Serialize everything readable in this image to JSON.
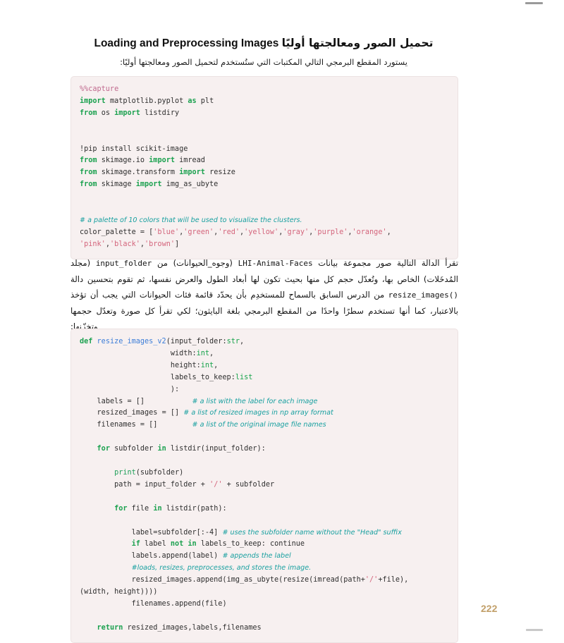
{
  "document": {
    "page_number": "222",
    "heading": {
      "arabic": "تحميل الصور ومعالجتها أوليًا",
      "english": "Loading and Preprocessing Images"
    },
    "subtitle": "يستورد المقطع البرمجي التالي المكتبات التي ستُستخدم لتحميل الصور ومعالجتها أوليًا:",
    "body_paragraph": {
      "part_1": "تقرأ الدالة التالية صور مجموعة بيانات ",
      "inline_code_1": "LHI-Animal-Faces",
      "part_2": " (وجوه_الحيوانات) من ",
      "inline_code_2": "input_folder",
      "part_3": " (مجلد المُدخَلات) الخاص بها، وتُعدّل حجم كل منها بحيث تكون لها أبعاد الطول والعرض نفسها، ثم تقوم بتحسين دالة ",
      "inline_code_3": "resize_images()",
      "part_4": " من الدرس السابق بالسماح للمستخدِم بأن يحدّد قائمة فئات الحيوانات التي يجب أن تؤخذ بالاعتبار، كما أنها تستخدم سطرًا واحدًا من المقطع البرمجي بلغة البايثون؛ لكي تقرأ كل صورة وتعدّل حجمها وتخزّنها:"
    },
    "code_blocks": {
      "imports": {
        "lines": [
          "%%capture",
          "import matplotlib.pyplot as plt",
          "from os import listdiry",
          "",
          "!pip install scikit-image",
          "from skimage.io import imread",
          "from skimage.transform import resize",
          "from skimage import img_as_ubyte",
          "",
          "# a palette of 10 colors that will be used to visualize the clusters.",
          "color_palette = ['blue','green','red','yellow','gray','purple','orange',",
          "'pink','black','brown']"
        ],
        "tokens": {
          "magic_capture": "%%capture",
          "kw_import": "import",
          "kw_from": "from",
          "kw_as": "as",
          "module_matplotlib": "matplotlib.pyplot",
          "alias_plt": "plt",
          "module_os": "os",
          "name_listdiry": "listdiry",
          "shell_pip": "!pip install scikit-image",
          "module_skimage_io": "skimage.io",
          "name_imread": "imread",
          "module_skimage_transform": "skimage.transform",
          "name_resize": "resize",
          "module_skimage": "skimage",
          "name_img_as_ubyte": "img_as_ubyte",
          "comment_palette": "# a palette of 10 colors that will be used to visualize the clusters.",
          "var_color_palette": "color_palette",
          "palette_values": [
            "'blue'",
            "'green'",
            "'red'",
            "'yellow'",
            "'gray'",
            "'purple'",
            "'orange'",
            "'pink'",
            "'black'",
            "'brown'"
          ]
        }
      },
      "function": {
        "tokens": {
          "kw_def": "def",
          "fn_name": "resize_images_v2",
          "param_input_folder": "input_folder",
          "param_width": "width",
          "param_height": "height",
          "param_labels_to_keep": "labels_to_keep",
          "type_str": "str",
          "type_int": "int",
          "type_list": "list",
          "var_labels": "labels",
          "var_resized_images": "resized_images",
          "var_filenames": "filenames",
          "comment_labels": "# a list with the label for each image",
          "comment_resized": "# a list of resized images in np array format",
          "comment_filenames": "# a list of the original image file names",
          "kw_for": "for",
          "kw_in": "in",
          "kw_if": "if",
          "kw_not": "not",
          "kw_continue": "continue",
          "kw_return": "return",
          "builtin_print": "print",
          "name_listdir": "listdir",
          "var_subfolder": "subfolder",
          "var_path": "path",
          "var_file": "file",
          "var_label": "label",
          "str_slash": "'/'",
          "comment_suffix": "# uses the subfolder name without the \"Head\" suffix",
          "comment_appends": "# appends the label",
          "comment_loads": "#loads, resizes, preprocesses, and stores the image.",
          "call_img_as_ubyte": "img_as_ubyte",
          "call_resize": "resize",
          "call_imread": "imread",
          "slice_expr": "[:-4]",
          "width_height_tuple": "(width, height)"
        }
      }
    },
    "colors": {
      "code_background": "#f7f0f0",
      "keyword_green": "#1ba14f",
      "string_pink": "#d4657c",
      "comment_teal": "#19a0a0",
      "function_blue": "#3b7dd8",
      "page_number_gold": "#c2a06a",
      "text_black": "#1b1b1b"
    }
  }
}
